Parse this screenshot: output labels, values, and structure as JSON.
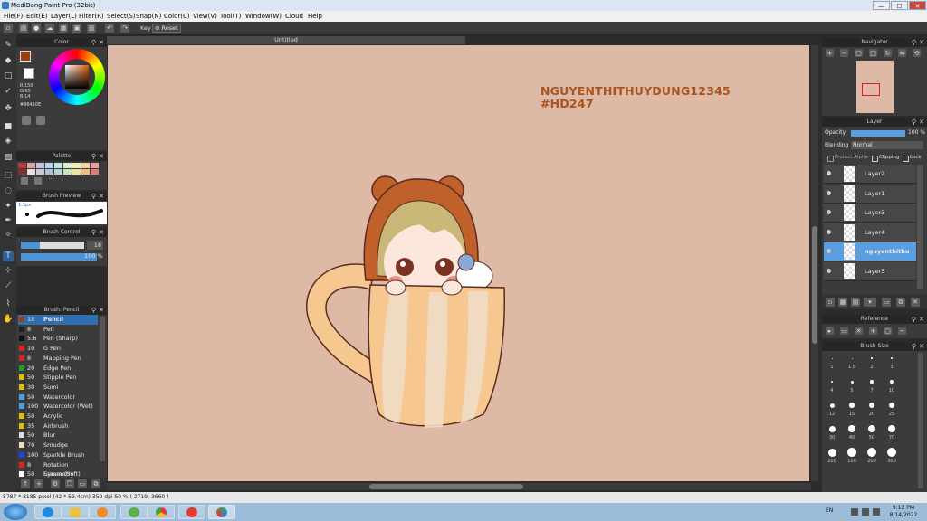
{
  "window": {
    "title": "MediBang Paint Pro (32bit)",
    "minimize": "—",
    "maximize": "☐",
    "close": "✕"
  },
  "menu": [
    "File(F)",
    "Edit(E)",
    "Layer(L)",
    "Filter(R)",
    "Select(S)",
    "Snap(N)",
    "Color(C)",
    "View(V)",
    "Tool(T)",
    "Window(W)",
    "Cloud",
    "Help"
  ],
  "toolbar": {
    "key_label": "Key",
    "reset_label": "Reset"
  },
  "canvas": {
    "tab_title": "Untitled",
    "artwork_text_line1": "NGUYENTHITHUYDUNG12345",
    "artwork_text_line2": "#HD247"
  },
  "color_panel": {
    "title": "Color",
    "r": "R:150",
    "g": "G:65",
    "b": "B:14",
    "hex": "#96410E",
    "main_color": "#96410e"
  },
  "palette": {
    "title": "Palette",
    "swatches": [
      "#b23b3b",
      "#d9a6a6",
      "#c9c2d6",
      "#b7d3e9",
      "#c5e4e1",
      "#ddeecc",
      "#f1ecb3",
      "#f5d0a0",
      "#e8a0a0",
      "#8a2f2f",
      "#e9e1e1",
      "#cfc8d8",
      "#a8c4de",
      "#b5d8d3",
      "#cce3b5",
      "#ece39a",
      "#f0c07e",
      "#e07a7a"
    ],
    "more": "···"
  },
  "brush_preview": {
    "title": "Brush Preview",
    "size_label": "1.3px"
  },
  "brush_control": {
    "title": "Brush Control",
    "size": "18",
    "opacity": "100 %",
    "size_frac": 0.3,
    "opacity_frac": 1.0
  },
  "brush_list": {
    "title": "Brush: Pencil",
    "items": [
      {
        "size": "18",
        "name": "Pencil",
        "color": "#96410e"
      },
      {
        "size": "8",
        "name": "Pen",
        "color": "#222222"
      },
      {
        "size": "5.6",
        "name": "Pen (Sharp)",
        "color": "#111111"
      },
      {
        "size": "10",
        "name": "G Pen",
        "color": "#e02020"
      },
      {
        "size": "8",
        "name": "Mapping Pen",
        "color": "#e02020"
      },
      {
        "size": "20",
        "name": "Edge Pen",
        "color": "#20a020"
      },
      {
        "size": "50",
        "name": "Stipple Pen",
        "color": "#e0c000"
      },
      {
        "size": "30",
        "name": "Sumi",
        "color": "#e0c000"
      },
      {
        "size": "50",
        "name": "Watercolor",
        "color": "#4aa0e0"
      },
      {
        "size": "100",
        "name": "Watercolor (Wet)",
        "color": "#4aa0e0"
      },
      {
        "size": "50",
        "name": "Acrylic",
        "color": "#e0c000"
      },
      {
        "size": "35",
        "name": "Airbrush",
        "color": "#e0c000"
      },
      {
        "size": "50",
        "name": "Blur",
        "color": "#dddddd"
      },
      {
        "size": "70",
        "name": "Smudge",
        "color": "#f0e0c0"
      },
      {
        "size": "100",
        "name": "Sparkle Brush",
        "color": "#2040e0"
      },
      {
        "size": "8",
        "name": "Rotation Symmetry",
        "color": "#e02020"
      },
      {
        "size": "50",
        "name": "Eraser (Soft)",
        "color": "#ffffff"
      }
    ]
  },
  "navigator": {
    "title": "Navigator"
  },
  "layer_panel": {
    "title": "Layer",
    "opacity_label": "Opacity",
    "opacity_value": "100 %",
    "blending_label": "Blending",
    "blending_value": "Normal",
    "protect_alpha": "Protect Alpha",
    "clipping": "Clipping",
    "lock": "Lock",
    "layers": [
      "Layer2",
      "Layer1",
      "Layer3",
      "Layer4",
      "nguyenthithu",
      "Layer5"
    ],
    "selected_index": 4
  },
  "reference": {
    "title": "Reference"
  },
  "brush_size": {
    "title": "Brush Size",
    "labels": [
      "1",
      "1.5",
      "2",
      "3",
      "4",
      "5",
      "7",
      "10",
      "12",
      "15",
      "20",
      "25",
      "30",
      "40",
      "50",
      "70",
      "100",
      "150",
      "200",
      "300"
    ]
  },
  "status": {
    "text": "5787 * 8185 pixel  (42 * 59.4cm)  350 dpi  50 %  ( 2719, 3660 )"
  },
  "tray": {
    "lang": "EN",
    "time": "9:12 PM",
    "date": "8/14/2022"
  }
}
